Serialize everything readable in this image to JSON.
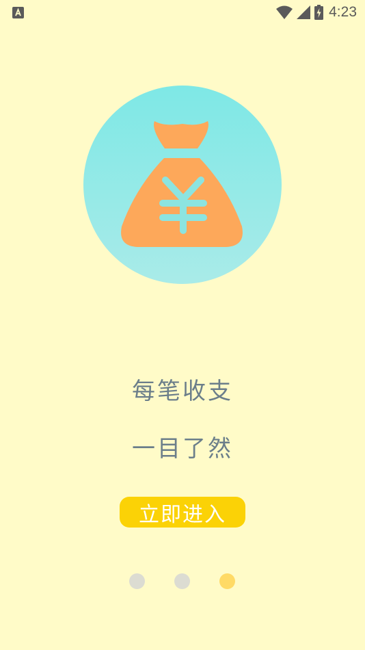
{
  "status_bar": {
    "time": "4:23",
    "icons": [
      "app-a-icon",
      "wifi-icon",
      "signal-icon",
      "battery-charging-icon"
    ]
  },
  "hero": {
    "icon": "money-bag-yuan-icon",
    "symbol": "¥",
    "colors": {
      "circle_top": "#7ee8e6",
      "circle_bottom": "#a9ebe8",
      "bag": "#fda85a",
      "symbol": "#8ce4e0"
    }
  },
  "content": {
    "line1": "每笔收支",
    "line2": "一目了然",
    "enter_label": "立即进入"
  },
  "pager": {
    "count": 3,
    "active_index": 2,
    "colors": {
      "inactive": "#dcdcd2",
      "active": "#ffda66"
    }
  },
  "theme": {
    "background": "#fffbc8",
    "button": "#fbd206",
    "text": "#6b7e8a"
  }
}
